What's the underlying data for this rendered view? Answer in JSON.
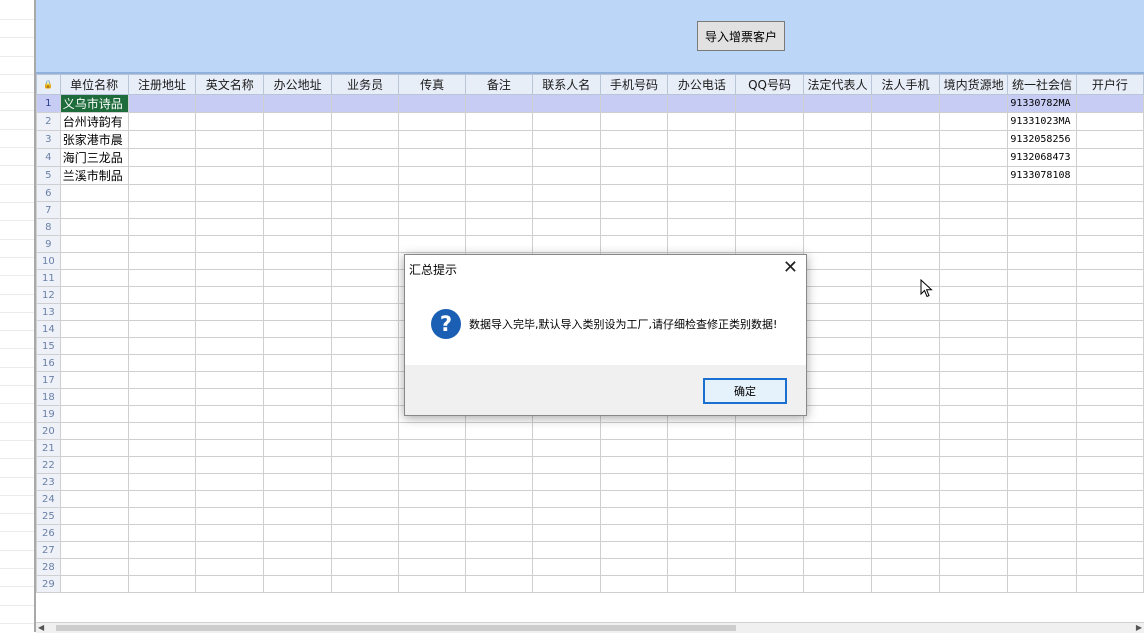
{
  "toolbar": {
    "import_button": "导入增票客户"
  },
  "grid": {
    "corner_icon": "lock-icon",
    "columns": [
      "单位名称",
      "注册地址",
      "英文名称",
      "办公地址",
      "业务员",
      "传真",
      "备注",
      "联系人名",
      "手机号码",
      "办公电话",
      "QQ号码",
      "法定代表人",
      "法人手机",
      "境内货源地",
      "统一社会信",
      "开户行"
    ],
    "rows": [
      {
        "no": "1",
        "name": "义乌市诗品",
        "credit": "91330782MA"
      },
      {
        "no": "2",
        "name": "台州诗韵有",
        "credit": "91331023MA"
      },
      {
        "no": "3",
        "name": "张家港市晨",
        "credit": "9132058256"
      },
      {
        "no": "4",
        "name": "海门三龙品",
        "credit": "9132068473"
      },
      {
        "no": "5",
        "name": "兰溪市制品",
        "credit": "9133078108"
      },
      {
        "no": "6",
        "name": "",
        "credit": ""
      },
      {
        "no": "7",
        "name": "",
        "credit": ""
      },
      {
        "no": "8",
        "name": "",
        "credit": ""
      },
      {
        "no": "9",
        "name": "",
        "credit": ""
      },
      {
        "no": "10",
        "name": "",
        "credit": ""
      },
      {
        "no": "11",
        "name": "",
        "credit": ""
      },
      {
        "no": "12",
        "name": "",
        "credit": ""
      },
      {
        "no": "13",
        "name": "",
        "credit": ""
      },
      {
        "no": "14",
        "name": "",
        "credit": ""
      },
      {
        "no": "15",
        "name": "",
        "credit": ""
      },
      {
        "no": "16",
        "name": "",
        "credit": ""
      },
      {
        "no": "17",
        "name": "",
        "credit": ""
      },
      {
        "no": "18",
        "name": "",
        "credit": ""
      },
      {
        "no": "19",
        "name": "",
        "credit": ""
      },
      {
        "no": "20",
        "name": "",
        "credit": ""
      },
      {
        "no": "21",
        "name": "",
        "credit": ""
      },
      {
        "no": "22",
        "name": "",
        "credit": ""
      },
      {
        "no": "23",
        "name": "",
        "credit": ""
      },
      {
        "no": "24",
        "name": "",
        "credit": ""
      },
      {
        "no": "25",
        "name": "",
        "credit": ""
      },
      {
        "no": "26",
        "name": "",
        "credit": ""
      },
      {
        "no": "27",
        "name": "",
        "credit": ""
      },
      {
        "no": "28",
        "name": "",
        "credit": ""
      },
      {
        "no": "29",
        "name": "",
        "credit": ""
      }
    ]
  },
  "dialog": {
    "title": "汇总提示",
    "icon": "question-icon",
    "message": "数据导入完毕,默认导入类别设为工厂,请仔细检查修正类别数据!",
    "ok_label": "确定",
    "close_glyph": "✕",
    "info_glyph": "?"
  },
  "colors": {
    "header_bg": "#bbd6f7",
    "selected_row": "#c7ccf5",
    "selected_cell": "#1e6b3b",
    "info_icon": "#1a5fb4"
  }
}
